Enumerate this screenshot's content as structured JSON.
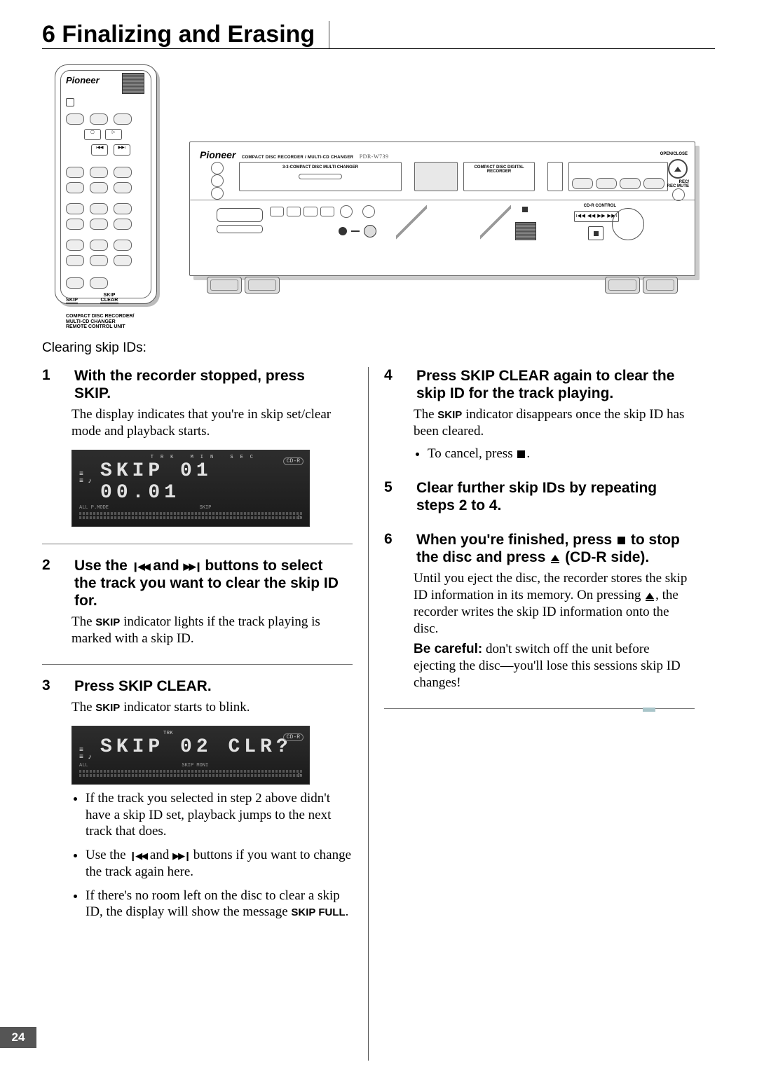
{
  "page_number": "24",
  "title": "6 Finalizing and Erasing",
  "intro": "Clearing skip IDs:",
  "remote": {
    "brand": "Pioneer",
    "skip_label": "SKIP",
    "skip_clear_label": "SKIP\nCLEAR",
    "caption_l1": "COMPACT DISC RECORDER/",
    "caption_l2": "MULTI-CD CHANGER",
    "caption_l3": "REMOTE CONTROL UNIT"
  },
  "unit": {
    "brand": "Pioneer",
    "subtitle": "COMPACT DISC RECORDER / MULTI-CD CHANGER",
    "model": "PDR-W739",
    "left_tray": "3-COMPACT DISC MULTI CHANGER",
    "right_tray": "COMPACT DISC DIGITAL RECORDER",
    "open_close": "OPEN/CLOSE",
    "rec_mute": "REC/\nREC MUTE",
    "cdr_control": "CD-R CONTROL",
    "transport": "ı◀◀ ◀◀   ▶▶ ▶▶ı"
  },
  "lcd1": {
    "main": "SKIP  01  00.01",
    "pill": "CD-R",
    "top_labels": "TRK        MIN    SEC",
    "sub_left": "ALL     P.MODE",
    "sub_mid": "SKIP"
  },
  "lcd2": {
    "main": "SKIP  02   CLR?",
    "pill": "CD-R",
    "top_labels": "TRK",
    "sub_left": "ALL",
    "sub_mid": "SKIP                         MONI"
  },
  "steps": {
    "s1": {
      "head": "With the recorder stopped, press SKIP.",
      "body": "The display indicates that you're in skip set/clear mode and playback starts."
    },
    "s2": {
      "head_a": "Use the ",
      "head_b": " and ",
      "head_c": " buttons to select  the track you want to clear the skip ID for.",
      "body_a": " The ",
      "body_b": "SKIP",
      "body_c": " indicator lights if the track playing is marked with a skip ID."
    },
    "s3": {
      "head": "Press SKIP CLEAR.",
      "body_a": "The ",
      "body_b": "SKIP",
      "body_c": " indicator starts to blink.",
      "li1": "If the track you selected in step 2 above didn't have a skip ID set, playback jumps to the next track that does.",
      "li2_a": "Use the ",
      "li2_b": " and ",
      "li2_c": " buttons if you want to change the track again here.",
      "li3_a": "If there's no room left on the disc to clear a skip ID, the display will show the message ",
      "li3_b": "SKIP FULL",
      "li3_c": "."
    },
    "s4": {
      "head": "Press SKIP CLEAR again to clear the skip ID for the track playing.",
      "body_a": "The ",
      "body_b": "SKIP",
      "body_c": " indicator disappears once the skip ID has been cleared.",
      "li1_a": "To cancel, press ",
      "li1_b": "."
    },
    "s5": {
      "head": "Clear further skip IDs by repeating steps 2 to 4."
    },
    "s6": {
      "head_a": "When you're finished, press ",
      "head_b": " to stop the disc and press ",
      "head_c": " (CD-R side).",
      "body_a": "Until you eject the disc, the recorder stores the skip ID information in its memory. On pressing ",
      "body_b": ", the recorder writes the skip ID information onto the disc.",
      "warn_a": "Be careful:",
      "warn_b": " don't switch off the unit before ejecting the disc—you'll lose this sessions skip ID changes!"
    }
  }
}
